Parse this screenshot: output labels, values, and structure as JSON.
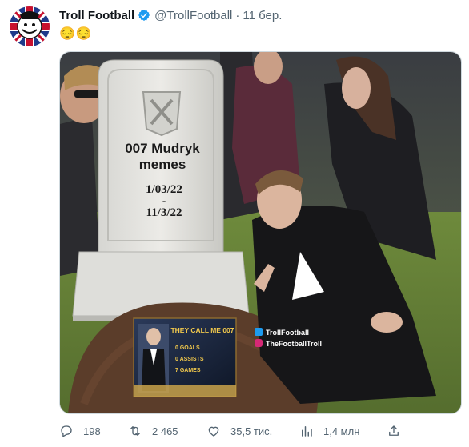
{
  "tweet": {
    "display_name": "Troll Football",
    "handle": "@TrollFootball",
    "separator": "·",
    "time": "11 бер.",
    "text": "😔😔",
    "avatar_icon": "troll-face-logo",
    "verified_color": "#1d9bf0"
  },
  "meme": {
    "grave_title_line1": "007 Mudryk",
    "grave_title_line2": "memes",
    "date_start": "1/03/22",
    "date_dash": "-",
    "date_end": "11/3/22",
    "card_title": "THEY CALL ME 007",
    "card_stats": [
      "0 GOALS",
      "0 ASSISTS",
      "7 GAMES"
    ],
    "watermark_twitter": "TrollFootball",
    "watermark_instagram": "TheFootballTroll"
  },
  "actions": {
    "replies": "198",
    "retweets": "2 465",
    "likes": "35,5 тис.",
    "views": "1,4 млн",
    "icons": [
      "reply-icon",
      "retweet-icon",
      "like-icon",
      "views-icon",
      "share-icon"
    ]
  }
}
